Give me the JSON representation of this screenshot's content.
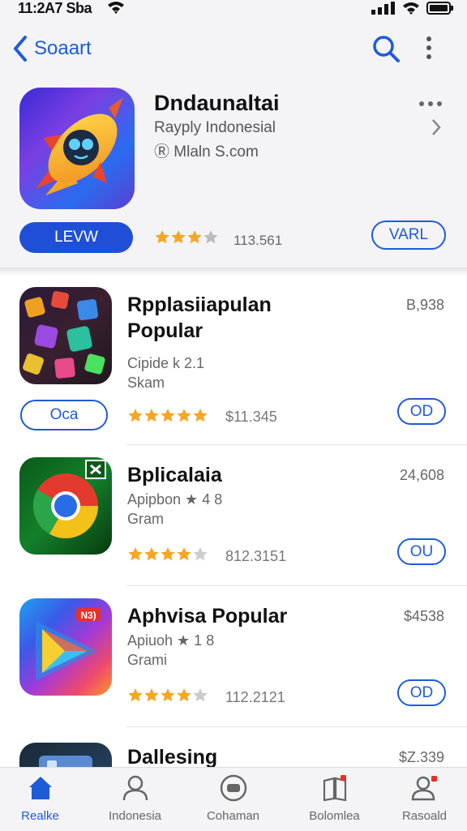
{
  "status": {
    "time": "11:2A7 Sba"
  },
  "nav": {
    "back_label": "Soaart"
  },
  "featured": {
    "title": "Dndaunaltai",
    "subtitle": "Rayply Indonesial",
    "developer": "Mlaln S.com",
    "left_button": "LEVW",
    "rating_count": "113.561",
    "right_button": "VARL"
  },
  "apps": [
    {
      "title_line1": "Rpplasiiapulan",
      "title_line2": "Popular",
      "subtitle": "Cipide k 2.1",
      "category": "Skam",
      "price": "B,938",
      "left_button": "Oca",
      "rating_count": "$11.345",
      "button": "OD"
    },
    {
      "title_line1": "Bplicalaia",
      "title_line2": "",
      "subtitle": "Apipbon ★ 4 8",
      "category": "Gram",
      "price": "24,608",
      "left_button": "",
      "rating_count": "812.3151",
      "button": "OU"
    },
    {
      "title_line1": "Aphvisa Popular",
      "title_line2": "",
      "subtitle": "Apiuoh ★ 1 8",
      "category": "Grami",
      "price": "$4538",
      "left_button": "",
      "rating_count": "112.2121",
      "button": "OD"
    },
    {
      "title_line1": "Dallesing",
      "title_line2": "",
      "subtitle": "",
      "category": "",
      "price": "$Z.339",
      "left_button": "",
      "rating_count": "",
      "button": ""
    }
  ],
  "tabs": [
    {
      "label": "Realke"
    },
    {
      "label": "Indonesia"
    },
    {
      "label": "Cohaman"
    },
    {
      "label": "Bolomlea"
    },
    {
      "label": "Rasoald"
    }
  ],
  "icons": {
    "back": "chevron-left-icon",
    "search": "search-icon",
    "more": "more-vertical-icon",
    "stars": "star-icon"
  },
  "colors": {
    "accent": "#1e5bd8",
    "star": "#f5a623"
  }
}
